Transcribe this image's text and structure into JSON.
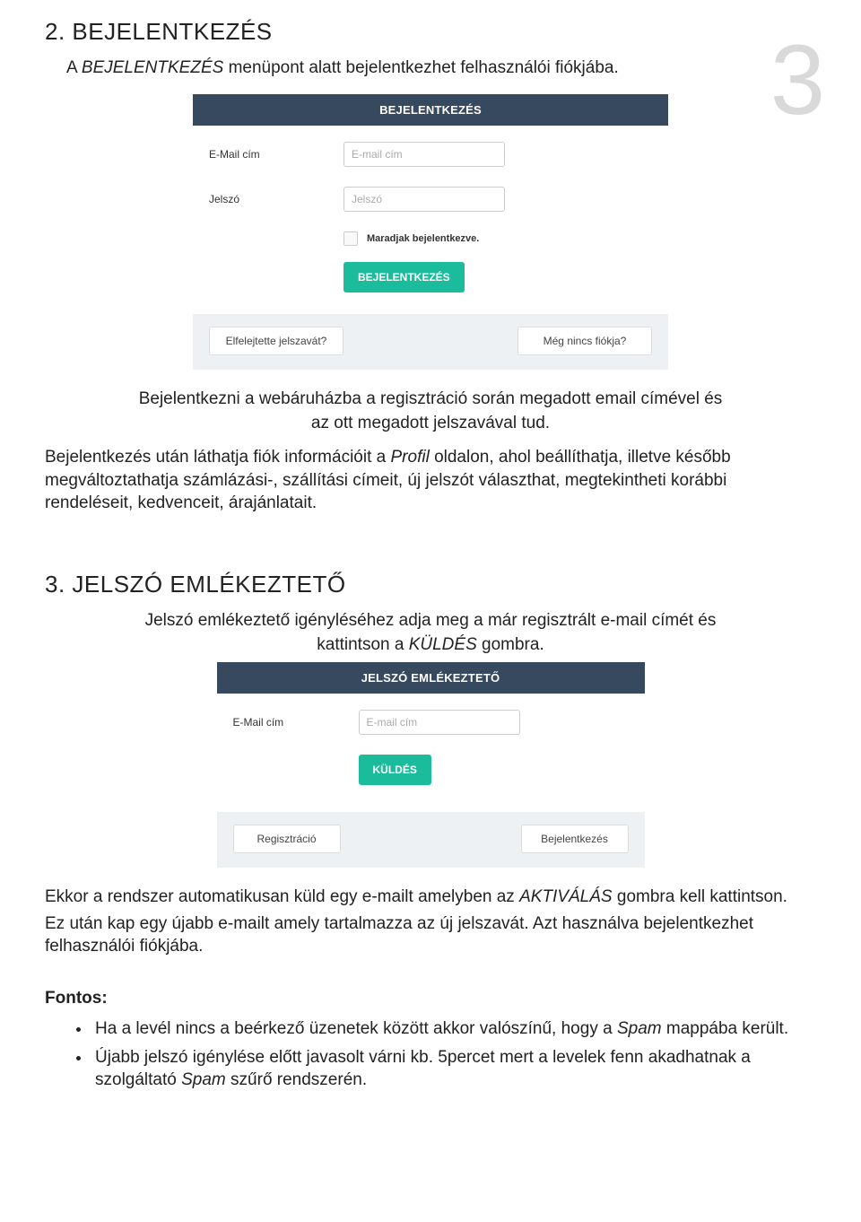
{
  "pageNumber": "3",
  "section1": {
    "heading": "2. BEJELENTKEZÉS",
    "intro_pre": "A ",
    "intro_italic": "BEJELENTKEZÉS",
    "intro_post": " menüpont alatt bejelentkezhet felhasználói fiókjába.",
    "shot": {
      "header": "BEJELENTKEZÉS",
      "emailLabel": "E-Mail cím",
      "emailPlaceholder": "E-mail cím",
      "pwLabel": "Jelszó",
      "pwPlaceholder": "Jelszó",
      "stayLabel": "Maradjak bejelentkezve.",
      "submit": "BEJELENTKEZÉS",
      "linkLeft": "Elfelejtette jelszavát?",
      "linkRight": "Még nincs fiókja?"
    },
    "para2a": "Bejelentkezni a webáruházba a regisztráció során megadott email címével és",
    "para2b": "az ott megadott jelszavával tud.",
    "para3_pre": "Bejelentkezés után láthatja fiók információit a ",
    "para3_italic": "Profil",
    "para3_post": " oldalon, ahol beállíthatja, illetve később megváltoztathatja számlázási-, szállítási címeit, új jelszót választhat, megtekintheti korábbi rendeléseit, kedvenceit, árajánlatait."
  },
  "section2": {
    "heading": "3. JELSZÓ EMLÉKEZTETŐ",
    "intro_a": "Jelszó emlékeztető igényléséhez adja meg a már regisztrált e-mail címét és",
    "intro_b_pre": "kattintson a ",
    "intro_b_italic": "KÜLDÉS",
    "intro_b_post": " gombra.",
    "shot": {
      "header": "JELSZÓ EMLÉKEZTETŐ",
      "emailLabel": "E-Mail cím",
      "emailPlaceholder": "E-mail cím",
      "submit": "KÜLDÉS",
      "linkLeft": "Regisztráció",
      "linkRight": "Bejelentkezés"
    },
    "para1_pre": "Ekkor a rendszer automatikusan küld egy e-mailt amelyben az ",
    "para1_italic": "AKTIVÁLÁS",
    "para1_post": " gombra kell kattintson.",
    "para2": "Ez után kap egy újabb e-mailt amely tartalmazza az új jelszavát. Azt használva bejelentkezhet felhasználói fiókjába.",
    "fontos": "Fontos:",
    "bullet1_pre": "Ha a levél nincs a beérkező üzenetek között akkor valószínű, hogy a ",
    "bullet1_italic": "Spam",
    "bullet1_post": " mappába került.",
    "bullet2_pre": "Újabb jelszó igénylése előtt javasolt várni kb. 5percet mert a levelek fenn akadhatnak a szolgáltató ",
    "bullet2_italic": "Spam",
    "bullet2_post": " szűrő rendszerén."
  }
}
